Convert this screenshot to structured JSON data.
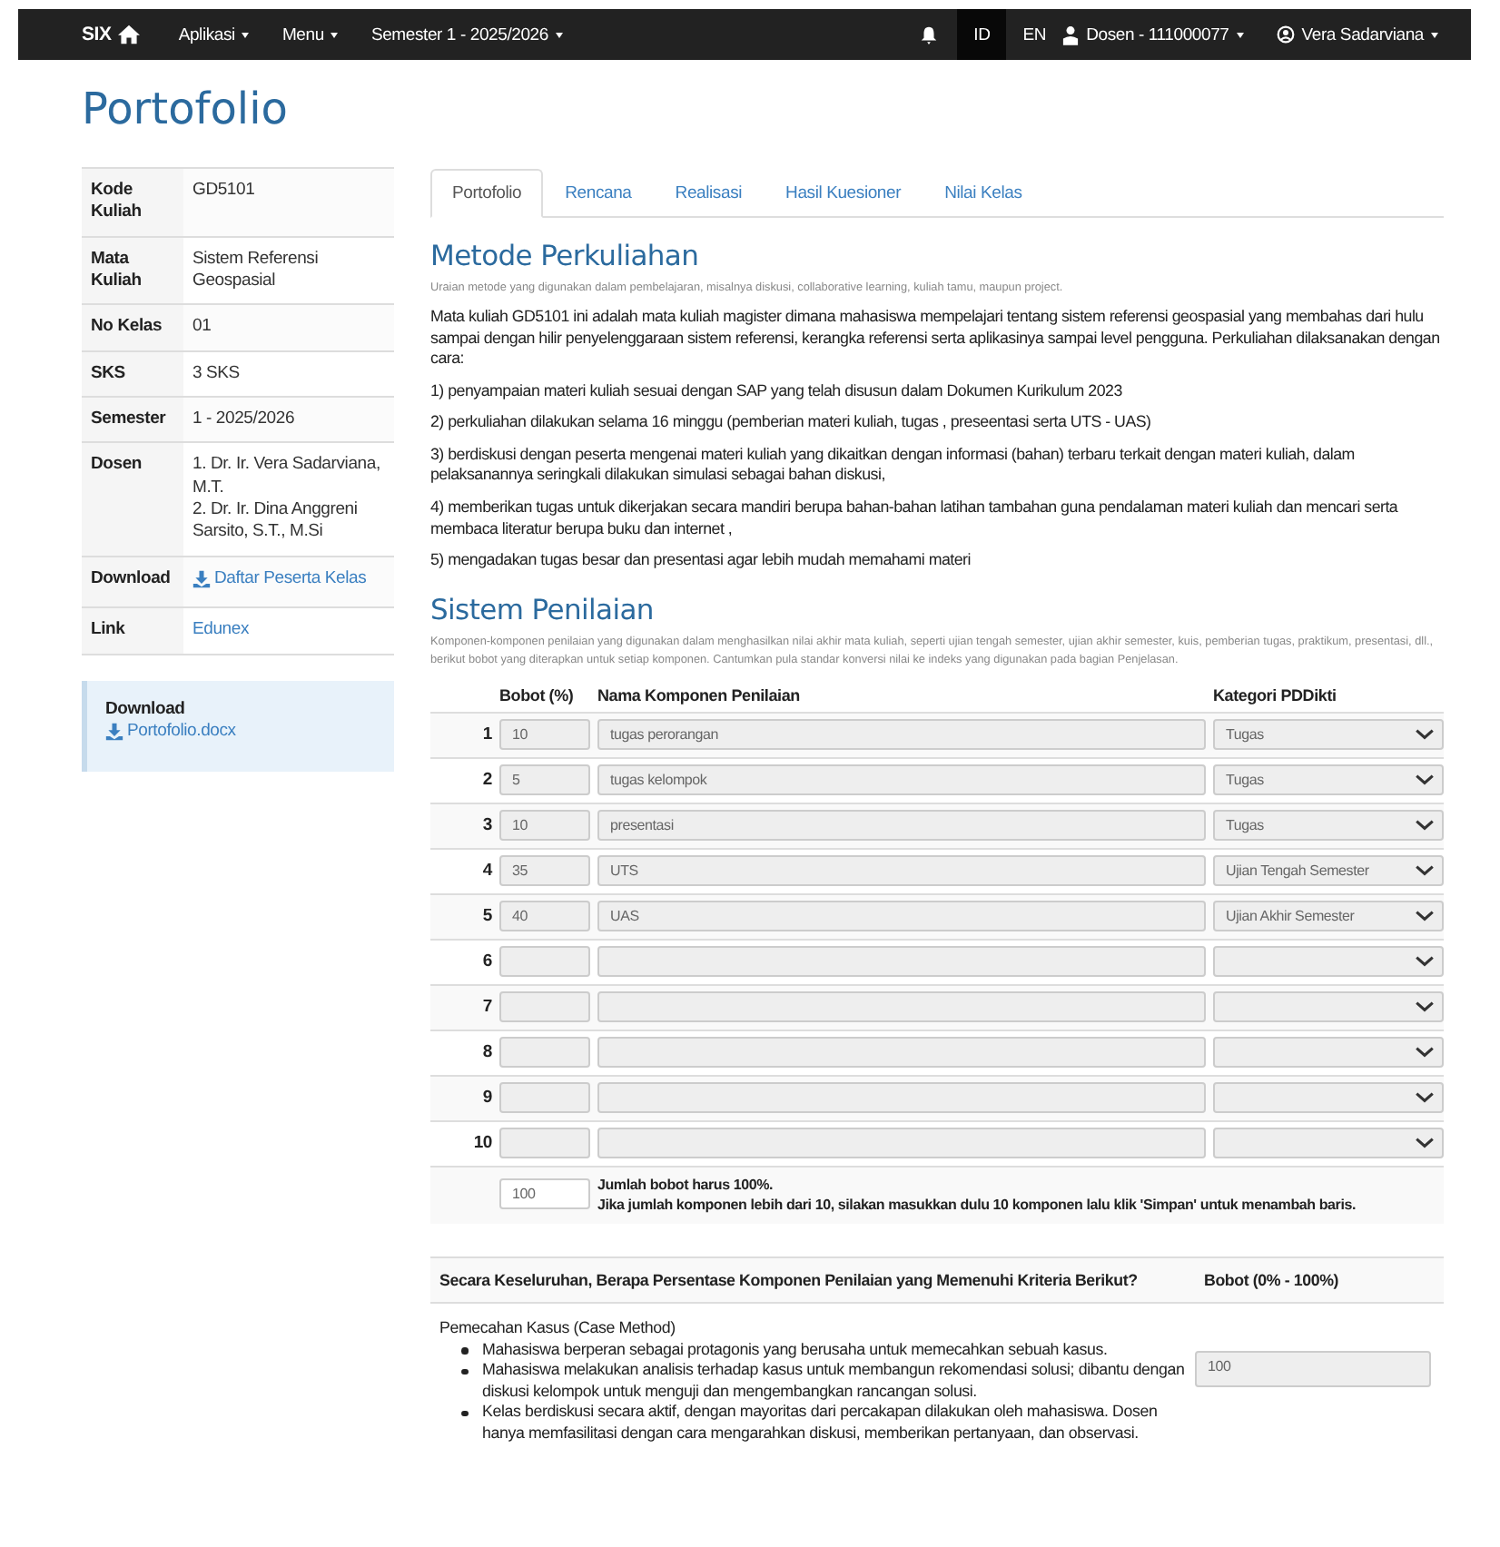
{
  "navbar": {
    "brand": "SIX",
    "menus": [
      {
        "label": "Aplikasi"
      },
      {
        "label": "Menu"
      },
      {
        "label": "Semester 1 - 2025/2026"
      }
    ],
    "languages": [
      {
        "label": "ID",
        "selected": true
      },
      {
        "label": "EN",
        "selected": false
      }
    ],
    "role": "Dosen - 111000077",
    "user": "Vera Sadarviana"
  },
  "page_title": "Portofolio",
  "info": [
    {
      "kind": "text",
      "label": "Kode Kuliah",
      "lines": [
        "GD5101"
      ]
    },
    {
      "kind": "text",
      "label": "Mata Kuliah",
      "lines": [
        "Sistem Referensi Geospasial"
      ]
    },
    {
      "kind": "text",
      "label": "No Kelas",
      "lines": [
        "01"
      ]
    },
    {
      "kind": "text",
      "label": "SKS",
      "lines": [
        "3 SKS"
      ]
    },
    {
      "kind": "text",
      "label": "Semester",
      "lines": [
        "1 - 2025/2026"
      ]
    },
    {
      "kind": "text",
      "label": "Dosen",
      "lines": [
        "1. Dr. Ir. Vera Sadarviana, M.T.",
        "2. Dr. Ir. Dina Anggreni Sarsito, S.T., M.Si"
      ]
    },
    {
      "kind": "download",
      "label": "Download",
      "lines": [
        "Daftar Peserta Kelas"
      ]
    },
    {
      "kind": "link",
      "label": "Link",
      "lines": [
        "Edunex"
      ]
    }
  ],
  "download_box": {
    "title": "Download",
    "link": "Portofolio.docx"
  },
  "tabs": [
    {
      "label": "Portofolio",
      "selected": true
    },
    {
      "label": "Rencana",
      "selected": false
    },
    {
      "label": "Realisasi",
      "selected": false
    },
    {
      "label": "Hasil Kuesioner",
      "selected": false
    },
    {
      "label": "Nilai Kelas",
      "selected": false
    }
  ],
  "metode": {
    "title": "Metode Perkuliahan",
    "hint": "Uraian metode yang digunakan dalam pembelajaran, misalnya diskusi, collaborative learning, kuliah tamu, maupun project.",
    "paragraphs": [
      "Mata kuliah GD5101 ini adalah mata kuliah magister dimana mahasiswa mempelajari tentang sistem referensi geospasial yang membahas dari hulu sampai dengan hilir penyelenggaraan sistem referensi, kerangka referensi serta aplikasinya sampai level pengguna. Perkuliahan dilaksanakan dengan cara:",
      "1) penyampaian materi kuliah sesuai dengan SAP yang telah disusun dalam Dokumen Kurikulum 2023",
      "2) perkuliahan dilakukan selama 16 minggu (pemberian materi kuliah,  tugas , preseentasi serta UTS - UAS)",
      "3) berdiskusi dengan peserta mengenai materi kuliah yang dikaitkan dengan informasi (bahan) terbaru terkait dengan materi kuliah, dalam pelaksanannya seringkali dilakukan simulasi sebagai bahan diskusi,",
      "4) memberikan tugas untuk dikerjakan secara mandiri berupa bahan-bahan latihan tambahan guna pendalaman materi kuliah dan mencari serta membaca literatur berupa buku dan internet ,",
      "5) mengadakan tugas besar dan presentasi agar lebih mudah memahami materi"
    ]
  },
  "penilaian": {
    "title": "Sistem Penilaian",
    "hint": "Komponen-komponen penilaian yang digunakan dalam menghasilkan nilai akhir mata kuliah, seperti ujian tengah semester, ujian akhir semester, kuis, pemberian tugas, praktikum, presentasi, dll., berikut bobot yang diterapkan untuk setiap komponen. Cantumkan pula standar konversi nilai ke indeks yang digunakan pada bagian Penjelasan.",
    "columns": [
      "Bobot (%)",
      "Nama Komponen Penilaian",
      "Kategori PDDikti"
    ],
    "rows": [
      {
        "no": "1",
        "bobot": "10",
        "nama": "tugas perorangan",
        "kategori": "Tugas"
      },
      {
        "no": "2",
        "bobot": "5",
        "nama": "tugas kelompok",
        "kategori": "Tugas"
      },
      {
        "no": "3",
        "bobot": "10",
        "nama": "presentasi",
        "kategori": "Tugas"
      },
      {
        "no": "4",
        "bobot": "35",
        "nama": "UTS",
        "kategori": "Ujian Tengah Semester"
      },
      {
        "no": "5",
        "bobot": "40",
        "nama": "UAS",
        "kategori": "Ujian Akhir Semester"
      },
      {
        "no": "6"
      },
      {
        "no": "7"
      },
      {
        "no": "8"
      },
      {
        "no": "9"
      },
      {
        "no": "10"
      }
    ],
    "total": "100",
    "notes": [
      "Jumlah bobot harus 100%.",
      "Jika jumlah komponen lebih dari 10, silakan masukkan dulu 10 komponen lalu klik 'Simpan' untuk menambah baris."
    ]
  },
  "kriteria": {
    "question": "Secara Keseluruhan, Berapa Persentase Komponen Penilaian yang Memenuhi Kriteria Berikut?",
    "weight_header": "Bobot (0% - 100%)",
    "items": [
      {
        "title": "Pemecahan Kasus (Case Method)",
        "bullets": [
          "Mahasiswa berperan sebagai protagonis yang berusaha untuk memecahkan sebuah kasus.",
          "Mahasiswa melakukan analisis terhadap kasus untuk membangun rekomendasi solusi; dibantu dengan diskusi kelompok untuk menguji dan mengembangkan rancangan solusi.",
          "Kelas berdiskusi secara aktif, dengan mayoritas dari percakapan dilakukan oleh mahasiswa. Dosen hanya memfasilitasi dengan cara mengarahkan diskusi, memberikan pertanyaan, dan observasi."
        ],
        "value": "100"
      }
    ]
  }
}
